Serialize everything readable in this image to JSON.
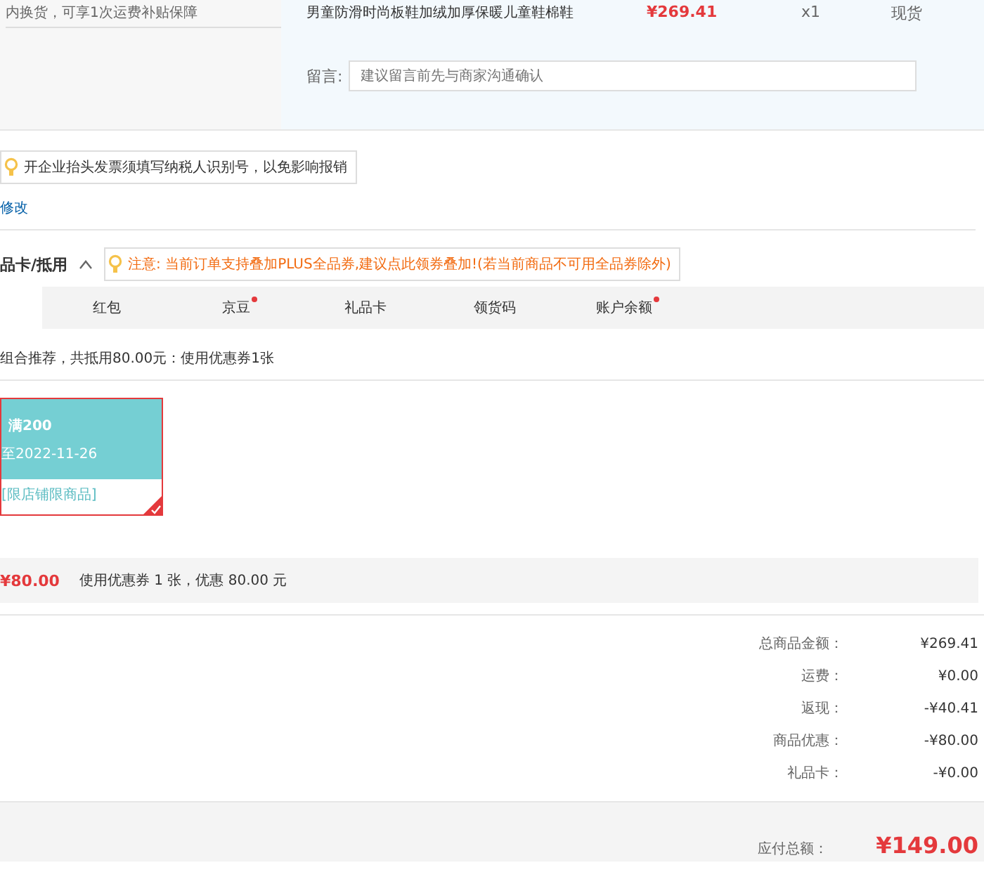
{
  "product": {
    "service_note": "内换货，可享1次运费补贴保障",
    "title_line": "男童防滑时尚板鞋加绒加厚保暖儿童鞋棉鞋",
    "price": "¥269.41",
    "quantity": "x1",
    "stock": "现货",
    "remark_label": "留言:",
    "remark_placeholder": "建议留言前先与商家沟通确认"
  },
  "invoice": {
    "tip": "开企业抬头发票须填写纳税人识别号，以免影响报销",
    "edit_link": "修改"
  },
  "discount": {
    "heading": "品卡/抵用",
    "expanded": true,
    "notice": "注意: 当前订单支持叠加PLUS全品券,建议点此领券叠加!(若当前商品不可用全品券除外)",
    "tabs": [
      {
        "label": "红包",
        "dot": false,
        "selected": false
      },
      {
        "label": "京豆",
        "dot": true,
        "selected": false
      },
      {
        "label": "礼品卡",
        "dot": false,
        "selected": false
      },
      {
        "label": "领货码",
        "dot": false,
        "selected": false
      },
      {
        "label": "账户余额",
        "dot": true,
        "selected": false
      }
    ],
    "recommend": "组合推荐，共抵用80.00元：使用优惠券1张",
    "coupons": [
      {
        "condition": "满200",
        "validity": "至2022-11-26",
        "scope": "[限店铺限商品]",
        "selected": true
      }
    ],
    "total_amount": "¥80.00",
    "total_text": "使用优惠券 1 张，优惠 80.00 元"
  },
  "summary": {
    "rows": [
      {
        "label": "总商品金额：",
        "value": "¥269.41"
      },
      {
        "label": "运费：",
        "value": "¥0.00"
      },
      {
        "label": "返现：",
        "value": "-¥40.41"
      },
      {
        "label": "商品优惠：",
        "value": "-¥80.00"
      },
      {
        "label": "礼品卡：",
        "value": "-¥0.00"
      }
    ],
    "payable_label": "应付总额：",
    "payable_value": "¥149.00"
  }
}
